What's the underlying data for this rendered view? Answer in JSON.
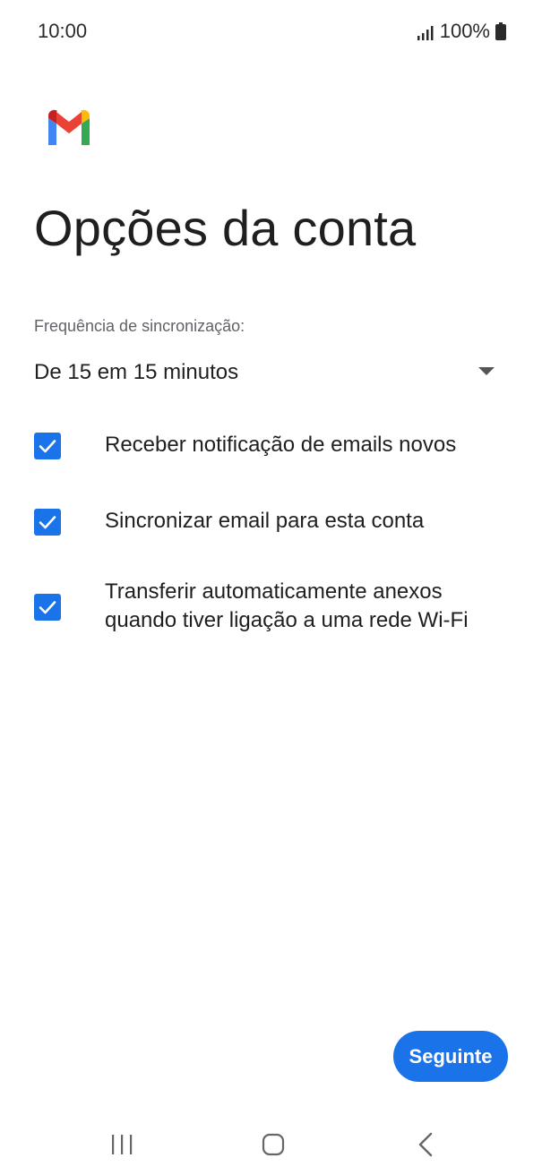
{
  "status_bar": {
    "time": "10:00",
    "battery": "100%"
  },
  "title": "Opções da conta",
  "sync": {
    "label": "Frequência de sincronização:",
    "value": "De 15 em 15 minutos"
  },
  "options": [
    {
      "label": "Receber notificação de emails novos",
      "checked": true
    },
    {
      "label": "Sincronizar email para esta conta",
      "checked": true
    },
    {
      "label": "Transferir automaticamente anexos quando tiver ligação a uma rede Wi-Fi",
      "checked": true
    }
  ],
  "next_button": "Seguinte",
  "colors": {
    "accent": "#1a73e8",
    "gmail_red": "#ea4335",
    "gmail_blue": "#4285f4",
    "gmail_green": "#34a853",
    "gmail_yellow": "#fbbc04",
    "gmail_darkred": "#c5221f"
  },
  "icons": {
    "signal": "signal-icon",
    "battery": "battery-icon",
    "logo": "gmail-logo",
    "dropdown": "dropdown-arrow-icon",
    "check": "check-icon",
    "recents": "recents-icon",
    "home": "home-icon",
    "back": "back-icon"
  }
}
